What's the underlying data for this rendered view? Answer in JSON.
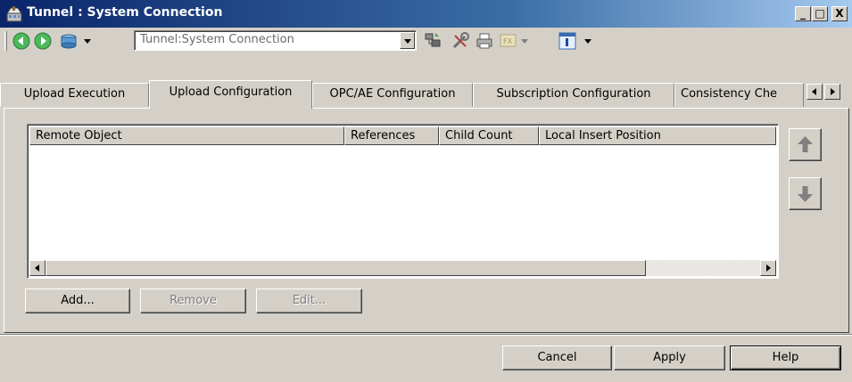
{
  "window": {
    "title": "Tunnel : System Connection",
    "caption_buttons": [
      "_",
      "□",
      "X"
    ]
  },
  "toolbar": {
    "back_icon": "back-arrow-icon",
    "forward_icon": "forward-arrow-icon",
    "object_icon": "object-icon",
    "path_value": "Tunnel:System Connection",
    "icons": [
      "view-icon",
      "structure-icon",
      "tools-icon",
      "print-icon",
      "inactive-icon",
      "info-icon"
    ]
  },
  "tabs": [
    {
      "label": "Upload Execution",
      "active": false
    },
    {
      "label": "Upload Configuration",
      "active": true
    },
    {
      "label": "OPC/AE Configuration",
      "active": false
    },
    {
      "label": "Subscription Configuration",
      "active": false
    },
    {
      "label": "Consistency Che",
      "active": false
    }
  ],
  "list": {
    "columns": [
      "Remote Object",
      "References",
      "Child Count",
      "Local Insert Position"
    ],
    "rows": []
  },
  "panel_buttons": {
    "add": "Add...",
    "remove": "Remove",
    "edit": "Edit..."
  },
  "dialog_buttons": {
    "cancel": "Cancel",
    "apply": "Apply",
    "help": "Help"
  },
  "colors": {
    "titlebar_start": "#0a246a",
    "titlebar_end": "#a6caf0",
    "face": "#d4d0c8",
    "arrow_green": "#3aa64a"
  }
}
